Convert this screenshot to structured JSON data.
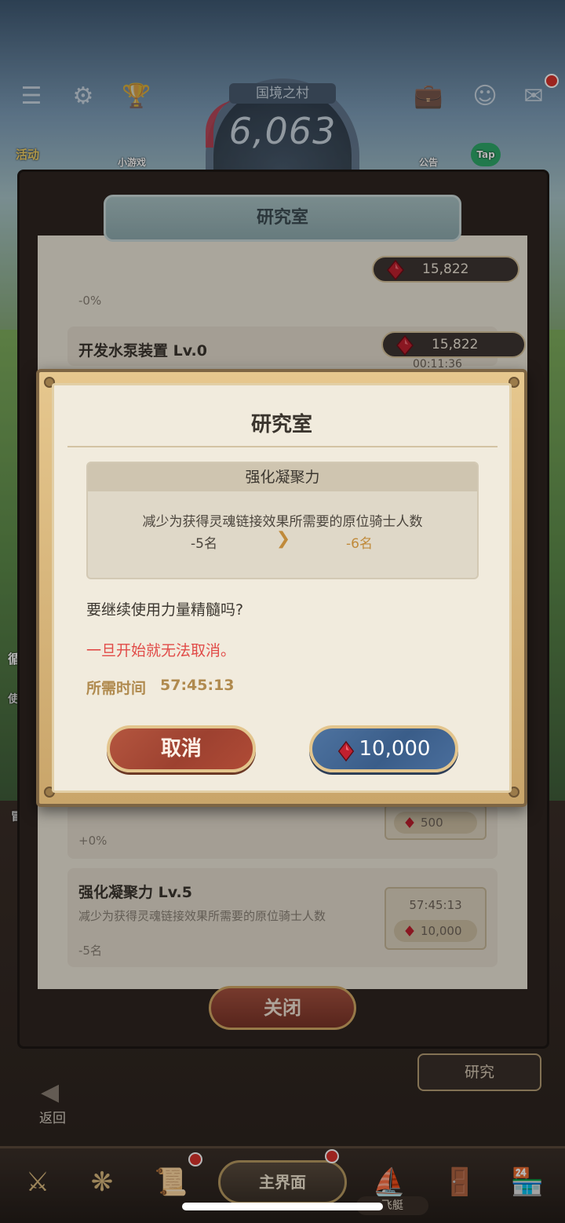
{
  "hud": {
    "village_name": "国境之村",
    "population": "6,063",
    "activity_label": "活动",
    "minigame_label": "小游戏",
    "notice_label": "公告",
    "tap_label": "Tap",
    "side_label_recycle": "循环",
    "side_label_use": "使用",
    "side_label_adventure": "冒"
  },
  "lab": {
    "header": "研究室",
    "top_gems": "15,822",
    "row_gems": "15,822",
    "partial_value": "-0%",
    "rows": [
      {
        "title": "开发水泵装置 Lv.0",
        "time": "00:11:36"
      },
      {
        "value": "+0%",
        "cost": "500"
      },
      {
        "title": "强化凝聚力 Lv.5",
        "desc": "减少为获得灵魂链接效果所需要的原位骑士人数",
        "value": "-5名",
        "time": "57:45:13",
        "cost": "10,000"
      }
    ],
    "close_label": "关闭",
    "research_label": "研究",
    "back_label": "返回"
  },
  "bottom_nav": {
    "main_label": "主界面",
    "airship_label": "飞艇"
  },
  "dialog": {
    "title": "研究室",
    "skill_name": "强化凝聚力",
    "description": "减少为获得灵魂链接效果所需要的原位骑士人数",
    "current_value": "-5名",
    "next_value": "-6名",
    "confirm_question": "要继续使用力量精髓吗?",
    "warning": "一旦开始就无法取消。",
    "time_label": "所需时间",
    "time_value": "57:45:13",
    "cancel_label": "取消",
    "cost": "10,000"
  },
  "colors": {
    "warning": "#e14b48",
    "gold_text": "#b08a4e",
    "cancel_button": "#a84a36",
    "confirm_button": "#3f6290",
    "gem": "#c0202f"
  },
  "icons": [
    "menu-icon",
    "gear-icon",
    "trophy-icon",
    "briefcase-icon",
    "friends-icon",
    "mail-icon",
    "gem-icon",
    "chevron-right-icon"
  ]
}
